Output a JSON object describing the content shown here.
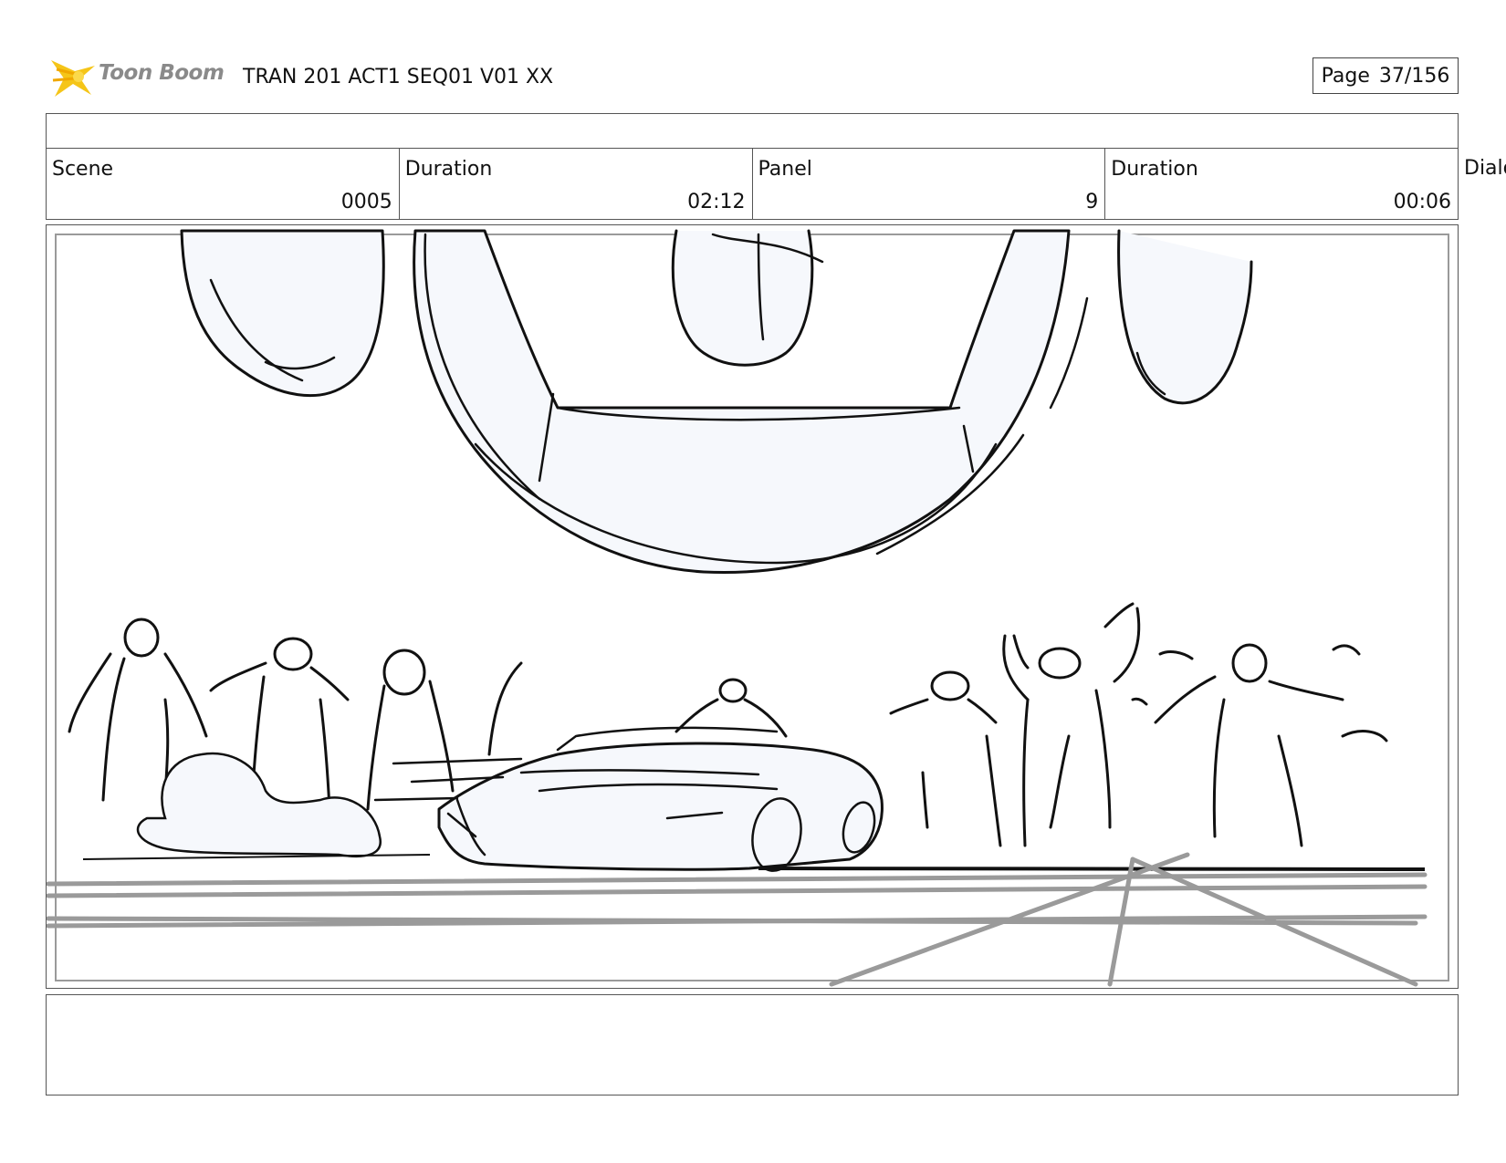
{
  "header": {
    "logo_text": "Toon Boom",
    "document_title": "TRAN 201 ACT1 SEQ01 V01 XX",
    "page_label": "Page",
    "page_number": "37/156"
  },
  "info": {
    "scene_label": "Scene",
    "scene_value": "0005",
    "duration_label": "Duration",
    "duration_value": "02:12",
    "panel_label": "Panel",
    "panel_value": "9",
    "panel_duration_label": "Duration",
    "panel_duration_value": "00:06",
    "dialog_label": "Dialog"
  },
  "panel_image": {
    "icon": "storyboard-sketch",
    "description_colors": {
      "line": "#111111",
      "fill": "#f6f8fc",
      "floor": "#9a9a9a"
    }
  },
  "colors": {
    "logo_star": "#f5c518",
    "logo_text": "#8a8a8a",
    "border": "#555555"
  }
}
